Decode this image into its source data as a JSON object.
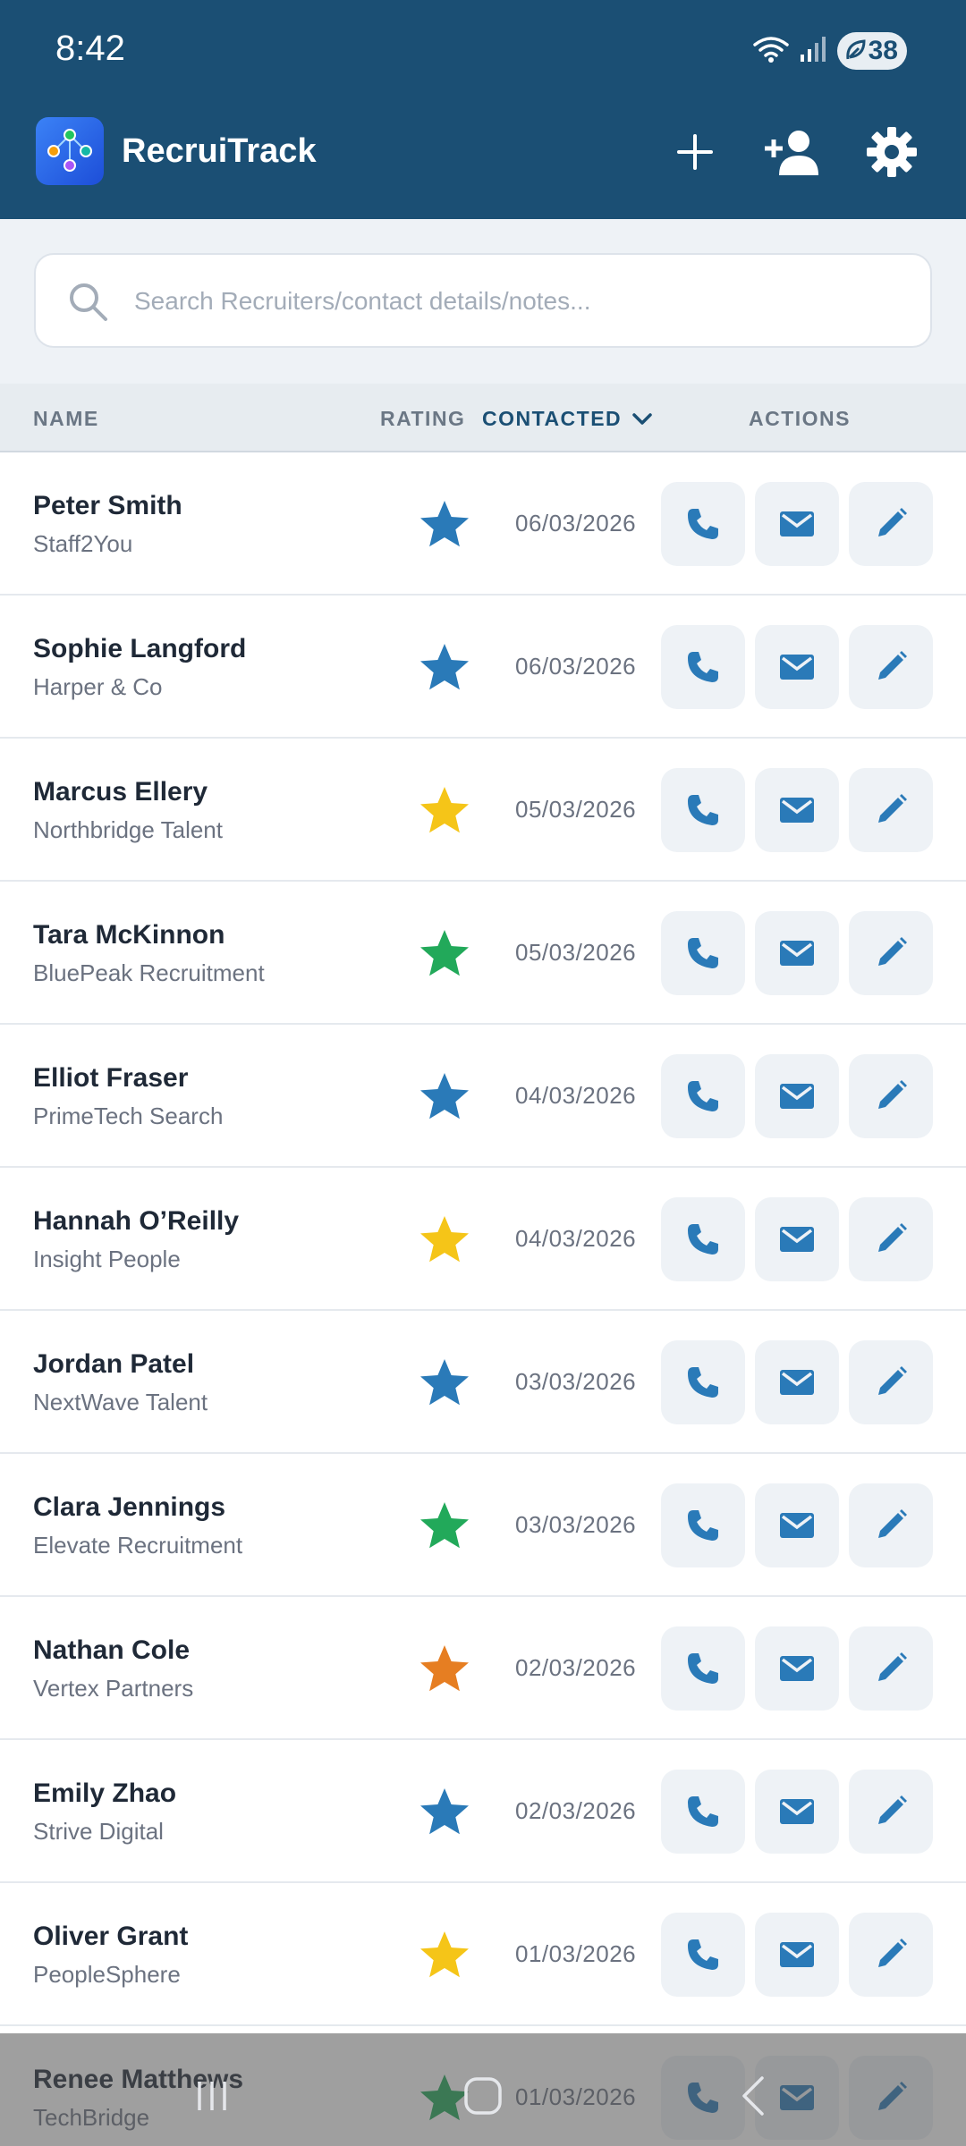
{
  "status_bar": {
    "time": "8:42",
    "battery": "38"
  },
  "app": {
    "title": "RecruiTrack"
  },
  "search": {
    "placeholder": "Search Recruiters/contact details/notes..."
  },
  "columns": {
    "name": "NAME",
    "rating": "RATING",
    "contacted": "CONTACTED",
    "actions": "ACTIONS"
  },
  "colors": {
    "header_bg": "#1b4f74",
    "accent": "#2a7ab8",
    "star_blue": "#2a7ab8",
    "star_yellow": "#f5c518",
    "star_green": "#22a95a",
    "star_orange": "#e67e22"
  },
  "recruiters": [
    {
      "name": "Peter Smith",
      "agency": "Staff2You",
      "rating": "blue",
      "contacted": "06/03/2026"
    },
    {
      "name": "Sophie Langford",
      "agency": "Harper & Co",
      "rating": "blue",
      "contacted": "06/03/2026"
    },
    {
      "name": "Marcus Ellery",
      "agency": "Northbridge Talent",
      "rating": "yellow",
      "contacted": "05/03/2026"
    },
    {
      "name": "Tara McKinnon",
      "agency": "BluePeak Recruitment",
      "rating": "green",
      "contacted": "05/03/2026"
    },
    {
      "name": "Elliot Fraser",
      "agency": "PrimeTech Search",
      "rating": "blue",
      "contacted": "04/03/2026"
    },
    {
      "name": "Hannah O’Reilly",
      "agency": "Insight People",
      "rating": "yellow",
      "contacted": "04/03/2026"
    },
    {
      "name": "Jordan Patel",
      "agency": "NextWave Talent",
      "rating": "blue",
      "contacted": "03/03/2026"
    },
    {
      "name": "Clara Jennings",
      "agency": "Elevate Recruitment",
      "rating": "green",
      "contacted": "03/03/2026"
    },
    {
      "name": "Nathan Cole",
      "agency": "Vertex Partners",
      "rating": "orange",
      "contacted": "02/03/2026"
    },
    {
      "name": "Emily Zhao",
      "agency": "Strive Digital",
      "rating": "blue",
      "contacted": "02/03/2026"
    },
    {
      "name": "Oliver Grant",
      "agency": "PeopleSphere",
      "rating": "yellow",
      "contacted": "01/03/2026"
    },
    {
      "name": "Renee Matthews",
      "agency": "TechBridge",
      "rating": "green",
      "contacted": "01/03/2026"
    }
  ]
}
